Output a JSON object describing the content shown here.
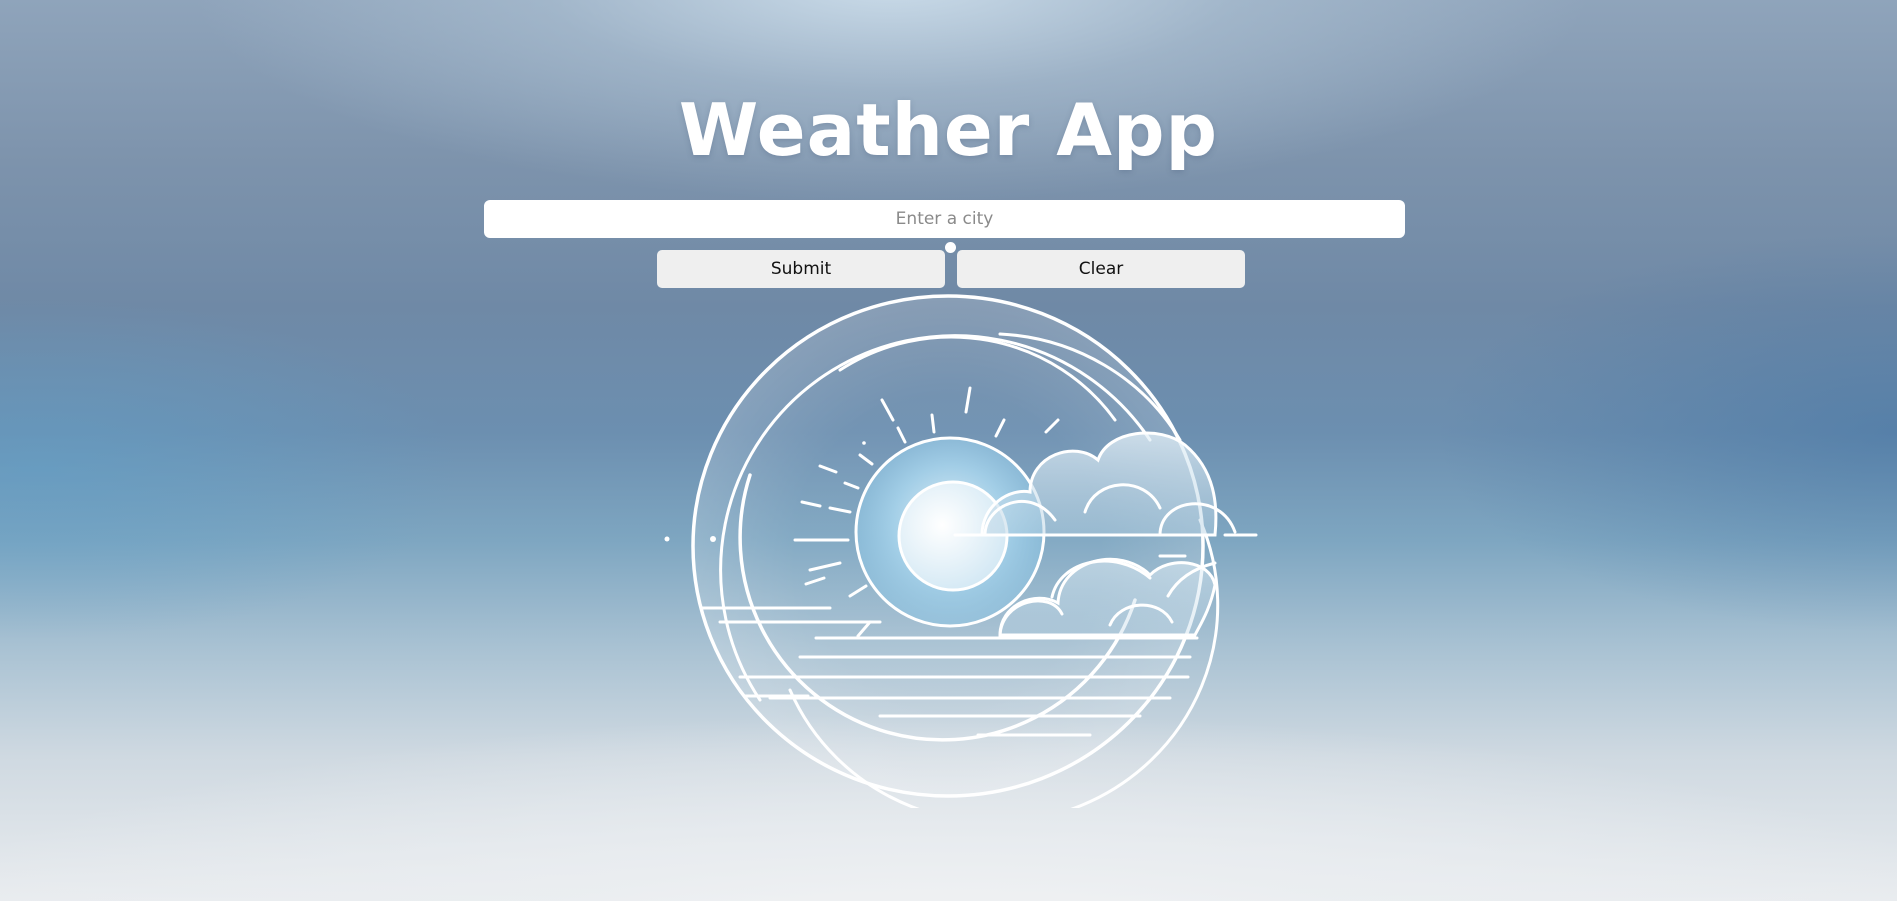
{
  "app": {
    "title": "Weather App"
  },
  "search": {
    "placeholder": "Enter a city",
    "value": ""
  },
  "buttons": {
    "submit_label": "Submit",
    "clear_label": "Clear"
  },
  "icons": {
    "illustration": "sun-cloud-illustration",
    "indicator": "dot-indicator"
  },
  "colors": {
    "title": "#ffffff",
    "input_bg": "#ffffff",
    "button_bg": "#efefef",
    "line_art": "#ffffff"
  }
}
